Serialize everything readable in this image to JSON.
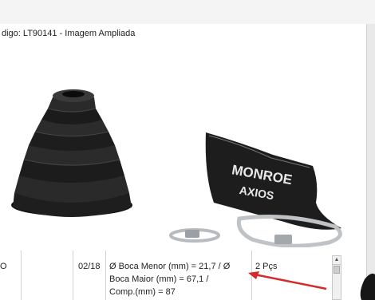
{
  "popup": {
    "title": "digo: LT90141 - Imagem Ampliada",
    "product_labels": [
      "MONROE",
      "AXIOS"
    ]
  },
  "table_row": {
    "col_first": "O",
    "col_code": "02/18",
    "description_lines": [
      "Ø Boca Menor (mm) = 21,7 / Ø",
      "Boca Maior (mm) = 67,1 /",
      "Comp.(mm) = 87"
    ],
    "quantity": "2 Pçs"
  },
  "scrollbar": {
    "up_glyph": "▲"
  },
  "colors": {
    "arrow": "#d62a2a",
    "boot": "#1c1c1c",
    "band": "#bfc3c6"
  }
}
